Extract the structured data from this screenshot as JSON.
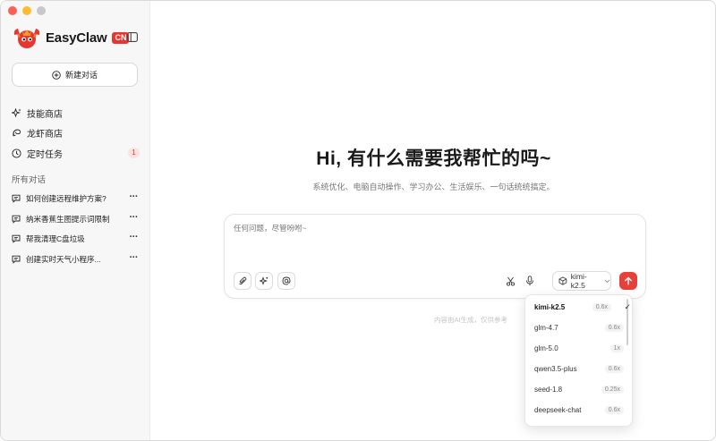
{
  "app": {
    "name": "EasyClaw",
    "tag": "CN",
    "traffic_colors": [
      "#ff5f57",
      "#febc2e",
      "#c8c8c8"
    ],
    "accent": "#e5362f"
  },
  "sidebar": {
    "new_chat_label": "新建对话",
    "nav": [
      {
        "label": "技能商店",
        "icon": "sparkle-icon"
      },
      {
        "label": "龙虾商店",
        "icon": "shrimp-icon"
      },
      {
        "label": "定时任务",
        "icon": "clock-icon",
        "badge": "1"
      }
    ],
    "section_title": "所有对话",
    "conversations": [
      {
        "title": "如何创建远程维护方案?"
      },
      {
        "title": "纳米香蕉生图提示词限制"
      },
      {
        "title": "帮我清理C盘垃圾"
      },
      {
        "title": "创建实时天气小程序..."
      }
    ]
  },
  "main": {
    "greeting": "Hi, 有什么需要我帮忙的吗~",
    "subtitle": "系统优化、电脑自动操作、学习办公、生活娱乐、一句话统统搞定。",
    "input_placeholder": "任何问题，尽管吩咐~",
    "model_selected": "kimi-k2.5",
    "disclaimer": "内容由AI生成，仅供参考"
  },
  "model_dropdown": {
    "options": [
      {
        "name": "kimi-k2.5",
        "multiplier": "0.6x",
        "selected": true
      },
      {
        "name": "glm-4.7",
        "multiplier": "0.6x"
      },
      {
        "name": "glm-5.0",
        "multiplier": "1x"
      },
      {
        "name": "qwen3.5-plus",
        "multiplier": "0.6x"
      },
      {
        "name": "seed-1.8",
        "multiplier": "0.25x"
      },
      {
        "name": "deepseek-chat",
        "multiplier": "0.6x"
      }
    ],
    "check_mark": "✓"
  }
}
